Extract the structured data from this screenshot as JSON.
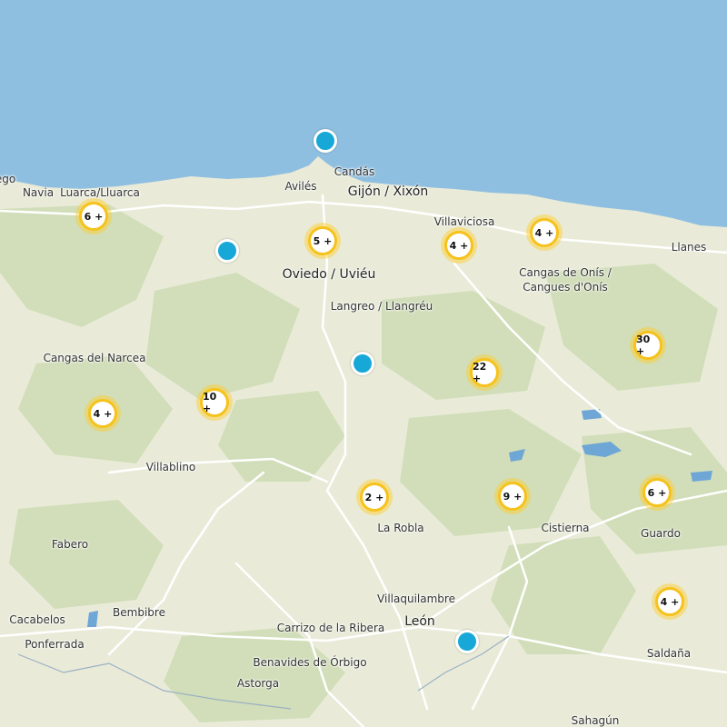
{
  "colors": {
    "sea": "#8fbfe0",
    "land": "#e9ebd8",
    "forest": "#c9dbb1",
    "road": "#ffffff",
    "water": "#6ea6d6",
    "cluster_ring": "#f6c21c",
    "marker": "#17a8d8"
  },
  "places": [
    {
      "name": "Candás",
      "type": "town"
    },
    {
      "name": "Avilés",
      "type": "town"
    },
    {
      "name": "Gijón / Xixón",
      "type": "city"
    },
    {
      "name": "Navia",
      "type": "town"
    },
    {
      "name": "Luarca/Lluarca",
      "type": "town"
    },
    {
      "name": "Villaviciosa",
      "type": "town"
    },
    {
      "name": "Llanes",
      "type": "town"
    },
    {
      "name": "Oviedo / Uviéu",
      "type": "city"
    },
    {
      "name": "Cangas de Onís /",
      "type": "town"
    },
    {
      "name": "Cangues d'Onís",
      "type": "town"
    },
    {
      "name": "Langreo / Llangréu",
      "type": "town"
    },
    {
      "name": "Cangas del Narcea",
      "type": "town"
    },
    {
      "name": "Villablino",
      "type": "town"
    },
    {
      "name": "La Robla",
      "type": "town"
    },
    {
      "name": "Cistierna",
      "type": "town"
    },
    {
      "name": "Guardo",
      "type": "town"
    },
    {
      "name": "Fabero",
      "type": "town"
    },
    {
      "name": "Villaquilambre",
      "type": "town"
    },
    {
      "name": "Cacabelos",
      "type": "town"
    },
    {
      "name": "Bembibre",
      "type": "town"
    },
    {
      "name": "Carrizo de la Ribera",
      "type": "town"
    },
    {
      "name": "León",
      "type": "city"
    },
    {
      "name": "Ponferrada",
      "type": "town"
    },
    {
      "name": "Benavides de Órbigo",
      "type": "town"
    },
    {
      "name": "Saldaña",
      "type": "town"
    },
    {
      "name": "Astorga",
      "type": "town"
    },
    {
      "name": "Sahagún",
      "type": "town"
    },
    {
      "name": "ego",
      "type": "town"
    }
  ],
  "clusters": [
    {
      "label": "6 +"
    },
    {
      "label": "5 +"
    },
    {
      "label": "4 +"
    },
    {
      "label": "4 +"
    },
    {
      "label": "30 +"
    },
    {
      "label": "22 +"
    },
    {
      "label": "4 +"
    },
    {
      "label": "10 +"
    },
    {
      "label": "2 +"
    },
    {
      "label": "9 +"
    },
    {
      "label": "6 +"
    },
    {
      "label": "4 +"
    }
  ],
  "markers": [
    {
      "name": "marker-candas"
    },
    {
      "name": "marker-west-oviedo"
    },
    {
      "name": "marker-central"
    },
    {
      "name": "marker-leon"
    }
  ]
}
